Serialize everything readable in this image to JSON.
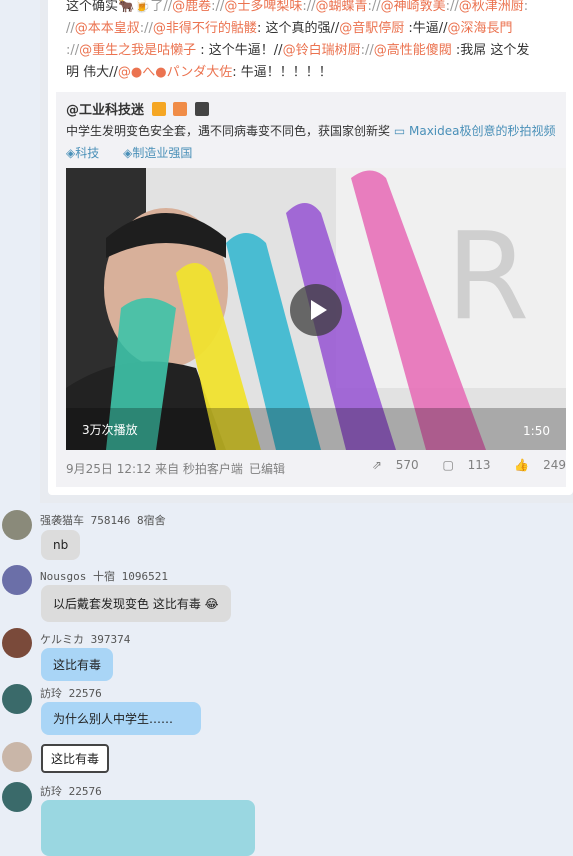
{
  "repost": {
    "line1": [
      {
        "t": "这个确实",
        "c": "text"
      },
      {
        "t": "🐂🍺",
        "c": "text"
      },
      {
        "t": "了//",
        "c": "sep"
      },
      {
        "t": "@鹿卷",
        "c": "mention"
      },
      {
        "t": "://",
        "c": "sep"
      },
      {
        "t": "@士多啤梨味",
        "c": "mention"
      },
      {
        "t": "://",
        "c": "sep"
      },
      {
        "t": "@蝴蝶青",
        "c": "mention"
      },
      {
        "t": "://",
        "c": "sep"
      },
      {
        "t": "@神崎敦美",
        "c": "mention"
      },
      {
        "t": "://",
        "c": "sep"
      },
      {
        "t": "@秋津洲厨",
        "c": "mention"
      },
      {
        "t": ":",
        "c": "sep"
      }
    ],
    "line2": [
      {
        "t": "//",
        "c": "sep"
      },
      {
        "t": "@本本皇叔",
        "c": "mention"
      },
      {
        "t": "://",
        "c": "sep"
      },
      {
        "t": "@非得不行的骷髅",
        "c": "mention"
      },
      {
        "t": ": 这个真的强//",
        "c": "text"
      },
      {
        "t": "@音駅停厨",
        "c": "mention"
      },
      {
        "t": " :牛逼//",
        "c": "text"
      },
      {
        "t": "@深海長門",
        "c": "mention"
      }
    ],
    "line3": [
      {
        "t": "://",
        "c": "sep"
      },
      {
        "t": "@重生之我是咕懒子",
        "c": "mention"
      },
      {
        "t": " : 这个牛逼！//",
        "c": "text"
      },
      {
        "t": "@铃白瑞树厨",
        "c": "mention"
      },
      {
        "t": "://",
        "c": "sep"
      },
      {
        "t": "@高性能傻閥",
        "c": "mention"
      },
      {
        "t": " :我屌 这个发",
        "c": "text"
      }
    ],
    "line4": [
      {
        "t": "明 伟大//",
        "c": "text"
      },
      {
        "t": "@●へ●パンダ大佐",
        "c": "mention"
      },
      {
        "t": ": 牛逼！！！！！",
        "c": "text"
      }
    ]
  },
  "original": {
    "author": "@工业科技迷",
    "text": "中学生发明变色安全套，遇不同病毒变不同色，获国家创新奖",
    "video_link": "Maxidea极创意的秒拍视频",
    "tags": [
      "科技",
      "制造业强国"
    ],
    "video": {
      "plays": "3万次播放",
      "duration": "1:50"
    },
    "meta": {
      "date": "9月25日 12:12 来自 秒拍客户端",
      "edited": "已编辑"
    },
    "stats": {
      "reposts": "570",
      "comments": "113",
      "likes": "249"
    }
  },
  "comments": [
    {
      "name": "强袭猫车",
      "id": "758146",
      "group": "8宿舍",
      "text": "nb",
      "style": "gray"
    },
    {
      "name": "Nousgos",
      "id": "1096521",
      "group": "十宿",
      "text": "以后戴套发现变色  这比有毒",
      "style": "gray",
      "emoji": "😂"
    },
    {
      "name": "ケルミカ",
      "id": "397374",
      "group": "",
      "text": "这比有毒",
      "style": "blue"
    },
    {
      "name": "訪玲",
      "id": "22576",
      "group": "",
      "text": "为什么别人中学生……",
      "style": "blue"
    },
    {
      "name": "",
      "id": "",
      "group": "",
      "text": "这比有毒",
      "style": "white"
    },
    {
      "name": "訪玲",
      "id": "22576",
      "group": "",
      "text": "",
      "style": "teal"
    }
  ],
  "colors": {
    "mention": "#eb7350",
    "link": "#4a90b8",
    "bubble_blue": "#a9d5f6",
    "bubble_gray": "#dcdcdc"
  }
}
